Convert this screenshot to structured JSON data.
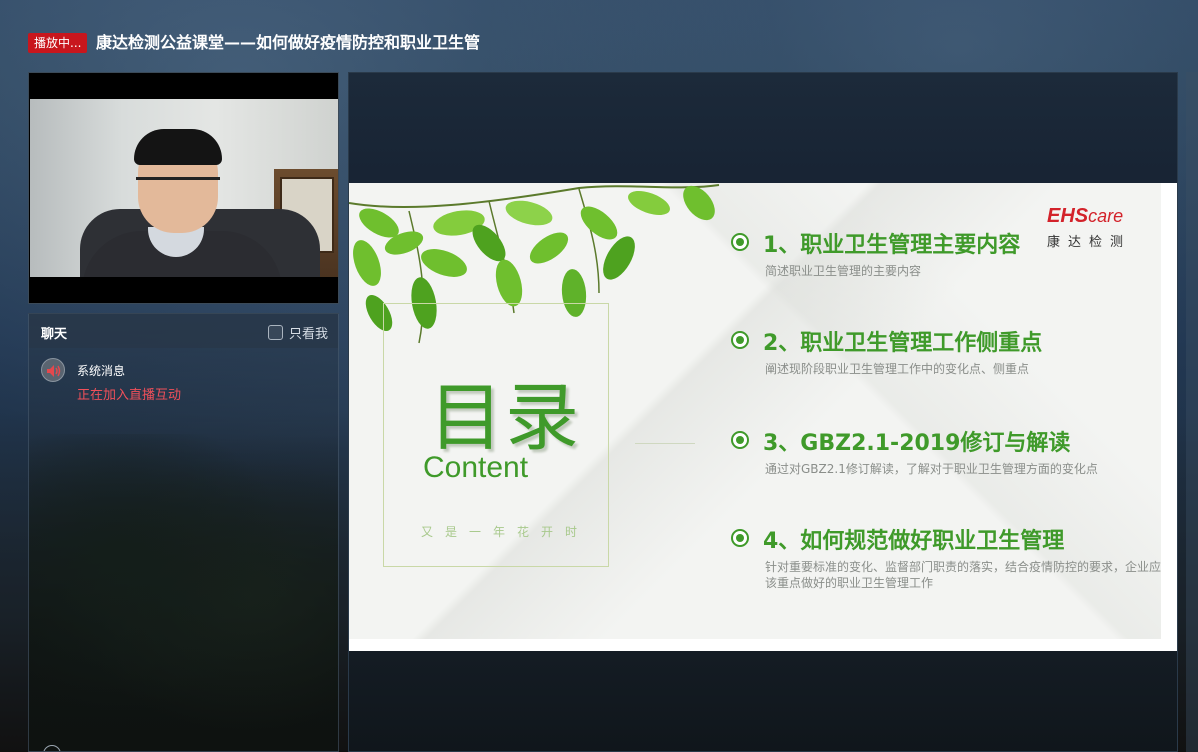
{
  "header": {
    "live_badge": "播放中...",
    "title": "康达检测公益课堂——如何做好疫情防控和职业卫生管"
  },
  "chat": {
    "title": "聊天",
    "only_me_label": "只看我",
    "messages": [
      {
        "sender": "系统消息",
        "text": "正在加入直播互动"
      }
    ]
  },
  "slide": {
    "title": "目录",
    "subtitle": "Content",
    "tagline": "又是一年花开时",
    "brand_logo_main": "EHS",
    "brand_logo_suffix": "care",
    "brand_name": "康达检测",
    "items": [
      {
        "heading": "1、职业卫生管理主要内容",
        "desc": "简述职业卫生管理的主要内容"
      },
      {
        "heading": "2、职业卫生管理工作侧重点",
        "desc": "阐述现阶段职业卫生管理工作中的变化点、侧重点"
      },
      {
        "heading": "3、GBZ2.1-2019修订与解读",
        "desc": "通过对GBZ2.1修订解读，了解对于职业卫生管理方面的变化点"
      },
      {
        "heading": "4、如何规范做好职业卫生管理",
        "desc": "针对重要标准的变化、监督部门职责的落实，结合疫情防控的要求，企业应该重点做好的职业卫生管理工作"
      }
    ]
  },
  "colors": {
    "accent_green": "#3f9a2a",
    "live_red": "#c8161d",
    "brand_red": "#d3222a",
    "system_msg_red": "#f0505a"
  }
}
